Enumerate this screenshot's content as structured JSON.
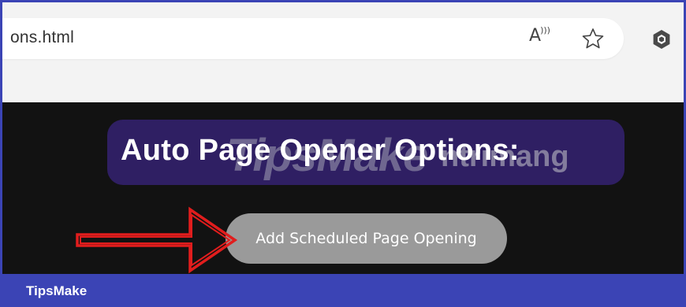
{
  "browser": {
    "url_text": "ons.html",
    "read_aloud_icon": "read-aloud-icon",
    "favorite_icon": "star-icon",
    "extension_icon": "extension-hexagon-icon"
  },
  "page": {
    "title": "Auto Page Opener Options:",
    "add_button_label": "Add Scheduled Page Opening",
    "watermark_brand": "TipsMake",
    "watermark_suffix": "ntrimang"
  },
  "footer": {
    "brand": "TipsMake"
  },
  "colors": {
    "frame_accent": "#3b44b5",
    "page_background": "#121212",
    "title_box": "#2f1f63",
    "button": "#9a9a9a",
    "arrow": "#e11d1d"
  }
}
